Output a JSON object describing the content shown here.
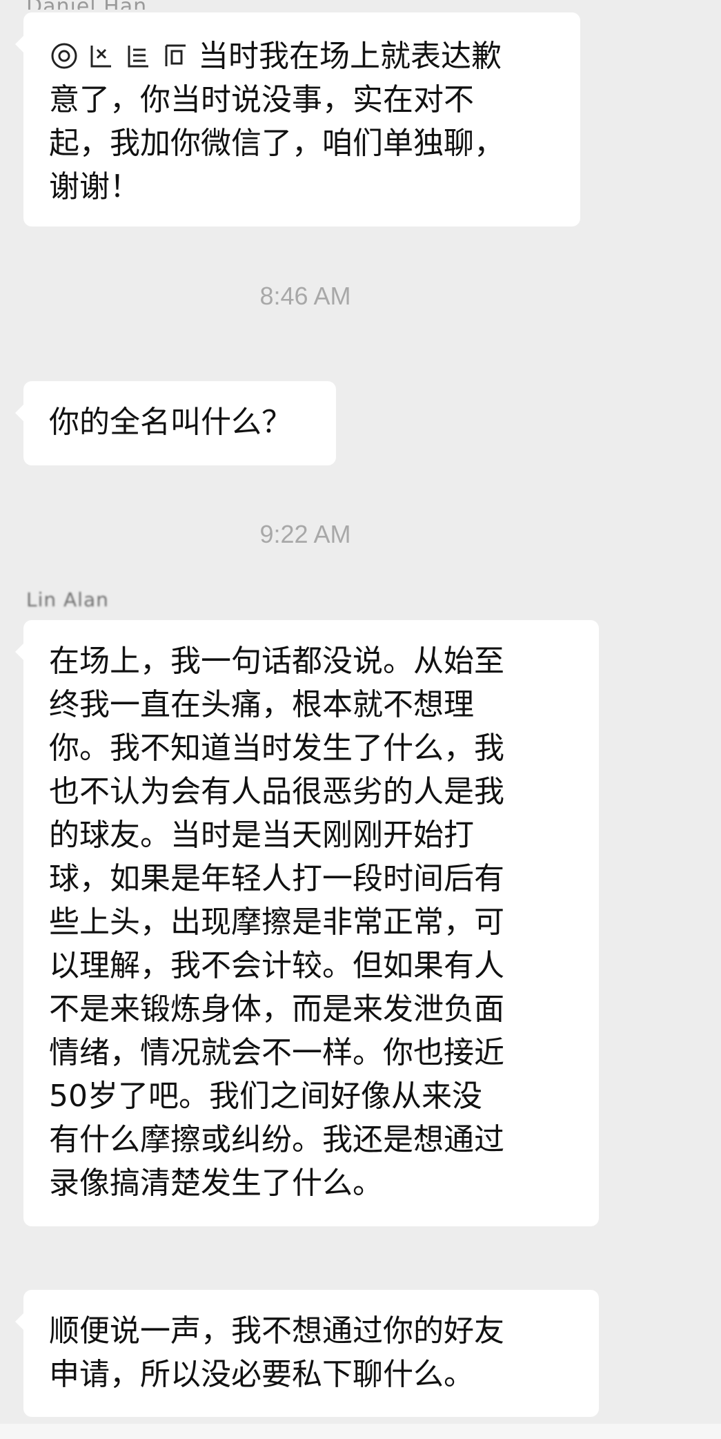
{
  "messages": [
    {
      "sender": "Daniel Han",
      "lines": [
        "当时我在场上就表达歉",
        "意了，你当时说没事，实在对不",
        "起，我加你微信了，咱们单独聊，",
        "谢谢！"
      ]
    },
    {
      "time": "8:46 AM"
    },
    {
      "lines": [
        "你的全名叫什么？"
      ]
    },
    {
      "time": "9:22 AM"
    },
    {
      "sender": "Lin Alan",
      "lines": [
        "在场上，我一句话都没说。从始至",
        "终我一直在头痛，根本就不想理",
        "你。我不知道当时发生了什么，我",
        "也不认为会有人品很恶劣的人是我",
        "的球友。当时是当天刚刚开始打",
        "球，如果是年轻人打一段时间后有",
        "些上头，出现摩擦是非常正常，可",
        "以理解，我不会计较。但如果有人",
        "不是来锻炼身体，而是来发泄负面",
        "情绪，情况就会不一样。你也接近",
        "50岁了吧。我们之间好像从来没",
        "有什么摩擦或纠纷。我还是想通过",
        "录像搞清楚发生了什么。"
      ]
    },
    {
      "lines": [
        "顺便说一声，我不想通过你的好友",
        "申请，所以没必要私下聊什么。"
      ]
    }
  ],
  "colors": {
    "background": "#ededed",
    "bubble": "#ffffff",
    "text": "#111111",
    "timestamp": "#a8a8a8"
  },
  "icons": [
    "emoji-icon"
  ]
}
